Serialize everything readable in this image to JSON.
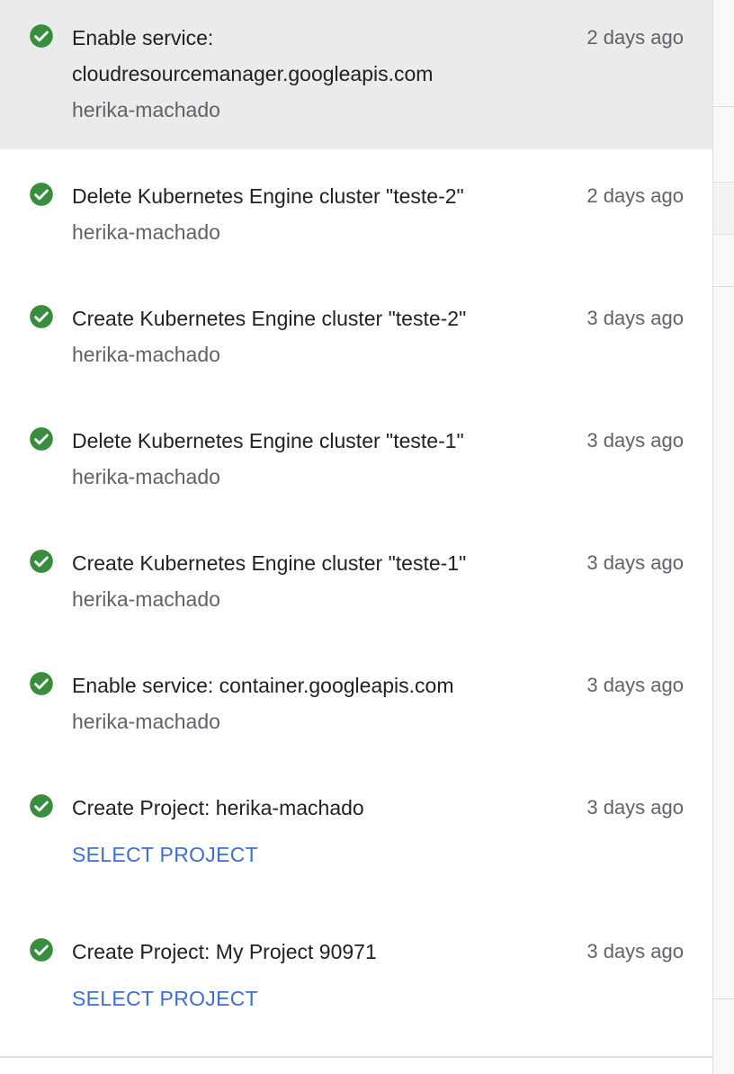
{
  "activity": {
    "items": [
      {
        "title": "Enable service: cloudresourcemanager.googleapis.com",
        "subtitle": "herika-machado",
        "time": "2 days ago",
        "status_icon": "check-circle-icon"
      },
      {
        "title": "Delete Kubernetes Engine cluster \"teste-2\"",
        "subtitle": "herika-machado",
        "time": "2 days ago",
        "status_icon": "check-circle-icon"
      },
      {
        "title": "Create Kubernetes Engine cluster \"teste-2\"",
        "subtitle": "herika-machado",
        "time": "3 days ago",
        "status_icon": "check-circle-icon"
      },
      {
        "title": "Delete Kubernetes Engine cluster \"teste-1\"",
        "subtitle": "herika-machado",
        "time": "3 days ago",
        "status_icon": "check-circle-icon"
      },
      {
        "title": "Create Kubernetes Engine cluster \"teste-1\"",
        "subtitle": "herika-machado",
        "time": "3 days ago",
        "status_icon": "check-circle-icon"
      },
      {
        "title": "Enable service: container.googleapis.com",
        "subtitle": "herika-machado",
        "time": "3 days ago",
        "status_icon": "check-circle-icon"
      },
      {
        "title": "Create Project: herika-machado",
        "action": "SELECT PROJECT",
        "time": "3 days ago",
        "status_icon": "check-circle-icon"
      },
      {
        "title": "Create Project: My Project 90971",
        "action": "SELECT PROJECT",
        "time": "3 days ago",
        "status_icon": "check-circle-icon"
      }
    ]
  },
  "colors": {
    "success": "#388e3c",
    "link": "#3b6fd4",
    "selected_bg": "#ebebeb"
  }
}
